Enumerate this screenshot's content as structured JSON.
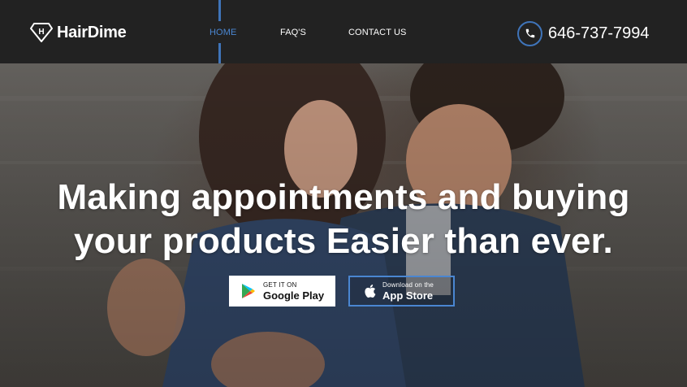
{
  "brand": {
    "name": "HairDime",
    "logo_letter": "H"
  },
  "nav": {
    "items": [
      {
        "label": "HOME",
        "active": true
      },
      {
        "label": "FAQ'S",
        "active": false
      },
      {
        "label": "CONTACT US",
        "active": false
      }
    ]
  },
  "contact": {
    "phone": "646-737-7994",
    "icon": "phone-icon"
  },
  "hero": {
    "headline_line1": "Making appointments and buying",
    "headline_line2": "your products Easier than ever."
  },
  "store_buttons": {
    "google": {
      "small": "GET IT ON",
      "big": "Google Play",
      "icon": "google-play-icon"
    },
    "apple": {
      "small": "Download on the",
      "big": "App Store",
      "icon": "apple-icon"
    }
  },
  "colors": {
    "header_bg": "#222222",
    "accent": "#3f74b9",
    "active_nav": "#4a86d1",
    "text": "#ffffff"
  }
}
